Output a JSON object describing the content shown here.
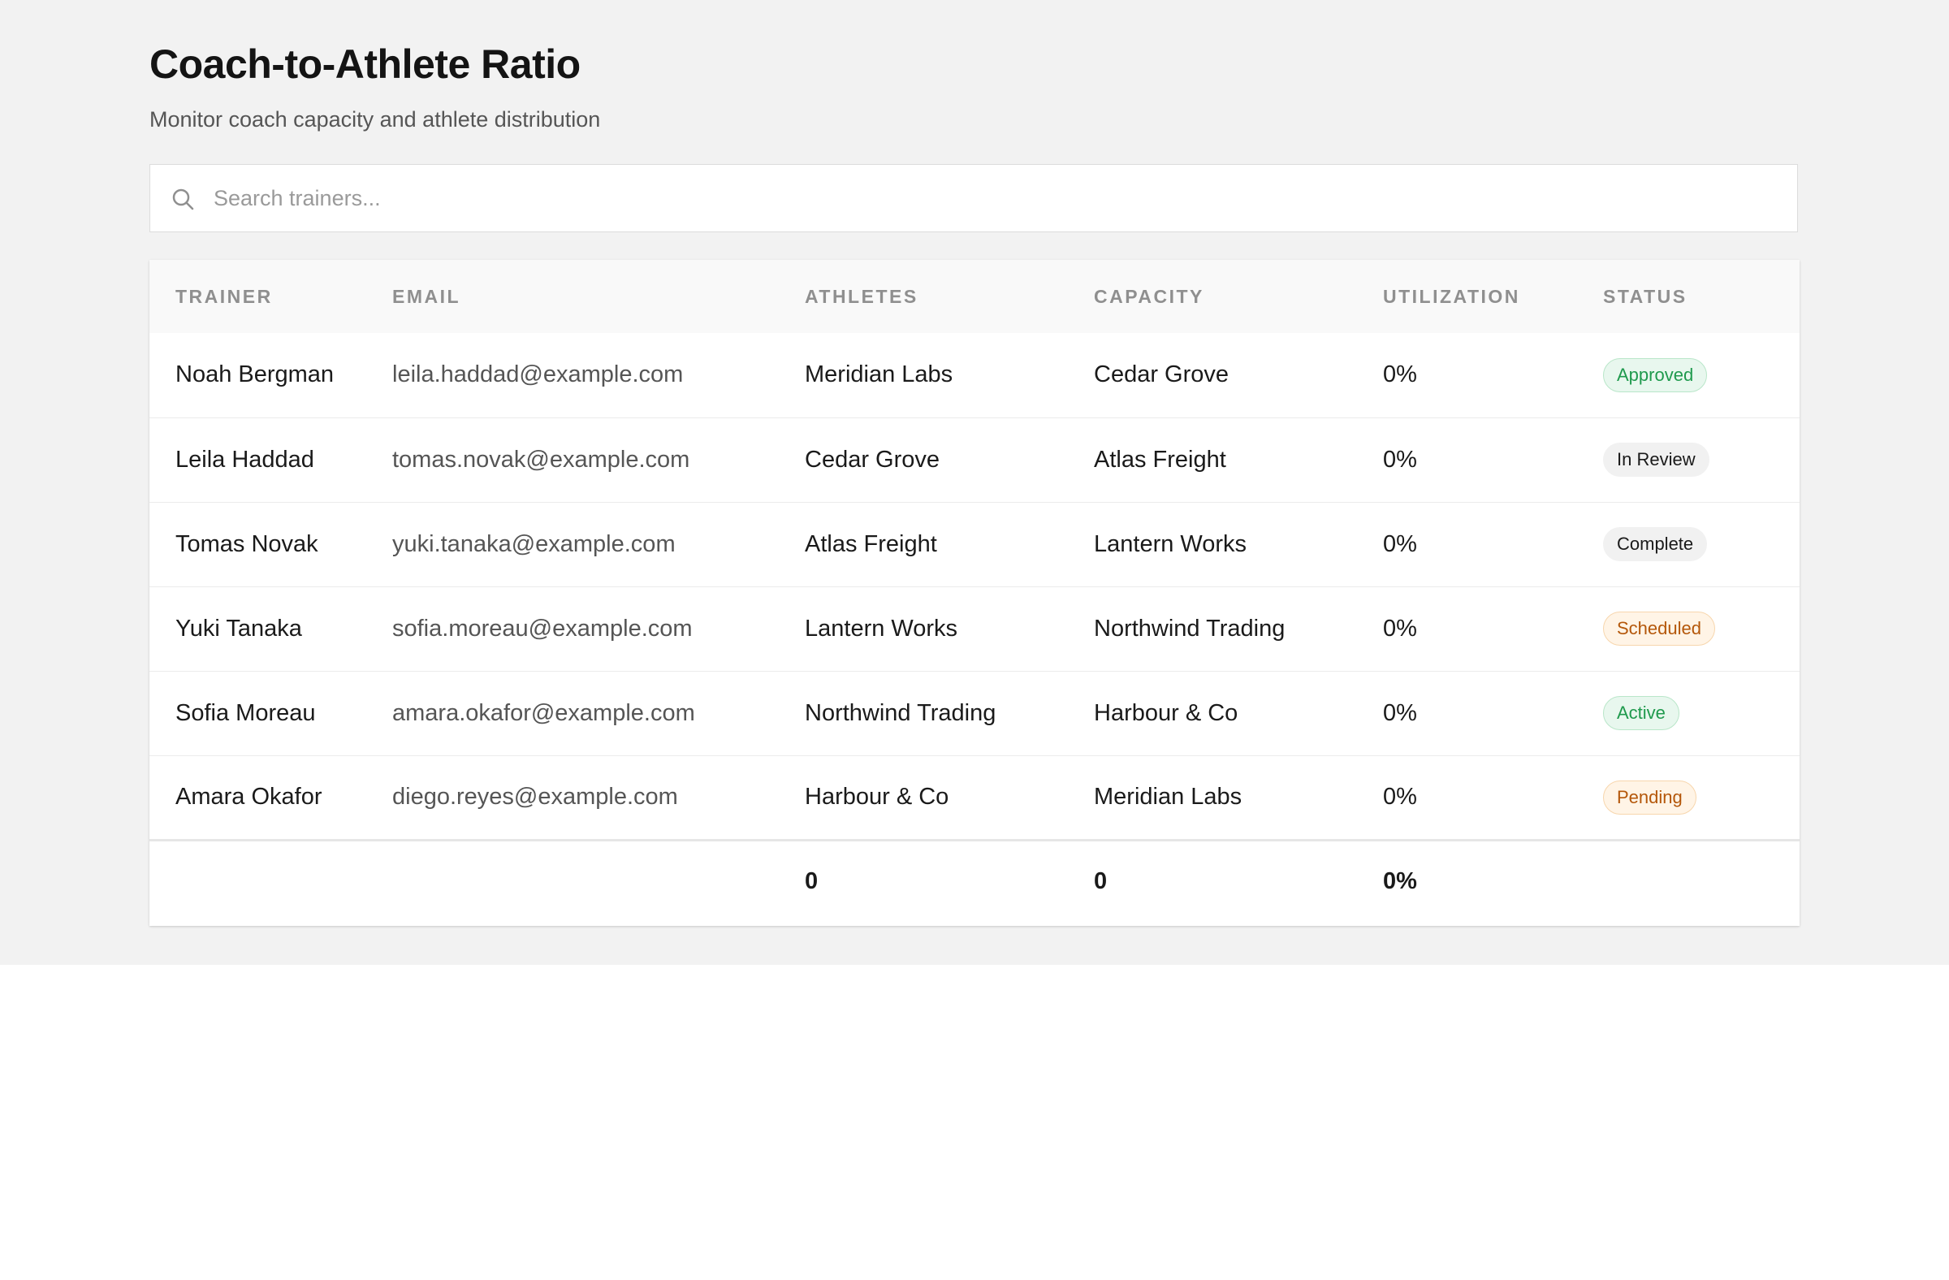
{
  "header": {
    "title": "Coach-to-Athlete Ratio",
    "subtitle": "Monitor coach capacity and athlete distribution"
  },
  "search": {
    "placeholder": "Search trainers...",
    "value": ""
  },
  "table": {
    "columns": [
      "TRAINER",
      "EMAIL",
      "ATHLETES",
      "CAPACITY",
      "UTILIZATION",
      "STATUS"
    ],
    "rows": [
      {
        "trainer": "Noah Bergman",
        "email": "leila.haddad@example.com",
        "athletes": "Meridian Labs",
        "capacity": "Cedar Grove",
        "utilization": "0%",
        "status": "Approved",
        "status_tone": "green"
      },
      {
        "trainer": "Leila Haddad",
        "email": "tomas.novak@example.com",
        "athletes": "Cedar Grove",
        "capacity": "Atlas Freight",
        "utilization": "0%",
        "status": "In Review",
        "status_tone": "gray"
      },
      {
        "trainer": "Tomas Novak",
        "email": "yuki.tanaka@example.com",
        "athletes": "Atlas Freight",
        "capacity": "Lantern Works",
        "utilization": "0%",
        "status": "Complete",
        "status_tone": "gray"
      },
      {
        "trainer": "Yuki Tanaka",
        "email": "sofia.moreau@example.com",
        "athletes": "Lantern Works",
        "capacity": "Northwind Trading",
        "utilization": "0%",
        "status": "Scheduled",
        "status_tone": "orange"
      },
      {
        "trainer": "Sofia Moreau",
        "email": "amara.okafor@example.com",
        "athletes": "Northwind Trading",
        "capacity": "Harbour & Co",
        "utilization": "0%",
        "status": "Active",
        "status_tone": "green"
      },
      {
        "trainer": "Amara Okafor",
        "email": "diego.reyes@example.com",
        "athletes": "Harbour & Co",
        "capacity": "Meridian Labs",
        "utilization": "0%",
        "status": "Pending",
        "status_tone": "orange"
      }
    ],
    "footer": {
      "athletes_total": "0",
      "capacity_total": "0",
      "utilization_total": "0%"
    }
  },
  "colors": {
    "page_background": "#f2f2f2",
    "badge_green": "#1f9a4d",
    "badge_orange": "#b4570a",
    "badge_gray": "#1a1a1a"
  },
  "icons": {
    "search": "search-icon"
  }
}
